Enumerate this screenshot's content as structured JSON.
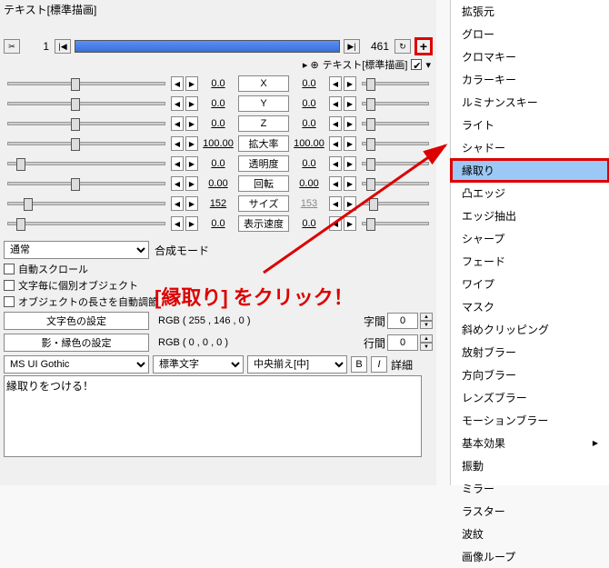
{
  "title": "テキスト[標準描画]",
  "timeline": {
    "start": "1",
    "end": "461"
  },
  "sub_header": "テキスト[標準描画]",
  "params": [
    {
      "lv": "0.0",
      "label": "X",
      "rv": "0.0",
      "lp": 40,
      "rp": 5
    },
    {
      "lv": "0.0",
      "label": "Y",
      "rv": "0.0",
      "lp": 40,
      "rp": 5
    },
    {
      "lv": "0.0",
      "label": "Z",
      "rv": "0.0",
      "lp": 40,
      "rp": 5
    },
    {
      "lv": "100.00",
      "label": "拡大率",
      "rv": "100.00",
      "lp": 40,
      "rp": 5
    },
    {
      "lv": "0.0",
      "label": "透明度",
      "rv": "0.0",
      "lp": 5,
      "rp": 5
    },
    {
      "lv": "0.00",
      "label": "回転",
      "rv": "0.00",
      "lp": 40,
      "rp": 5
    },
    {
      "lv": "152",
      "label": "サイズ",
      "rv": "153",
      "lp": 10,
      "rp": 10,
      "rdim": true
    },
    {
      "lv": "0.0",
      "label": "表示速度",
      "rv": "0.0",
      "lp": 5,
      "rp": 5
    }
  ],
  "blend_mode": {
    "value": "通常",
    "label": "合成モード"
  },
  "checkboxes": [
    "自動スクロール",
    "文字毎に個別オブジェクト",
    "オブジェクトの長さを自動調節"
  ],
  "color_buttons": {
    "text": "文字色の設定",
    "shadow": "影・縁色の設定"
  },
  "rgb": {
    "text": "RGB ( 255 , 146 , 0 )",
    "shadow": "RGB ( 0 , 0 , 0 )"
  },
  "spacing": {
    "char_label": "字間",
    "char_val": "0",
    "line_label": "行間",
    "line_val": "0"
  },
  "font": "MS UI Gothic",
  "char_type": "標準文字",
  "align": "中央揃え[中]",
  "bi": {
    "b": "B",
    "i": "I",
    "detail": "詳細"
  },
  "text_content": "縁取りをつける！",
  "menu": [
    {
      "label": "拡張元"
    },
    {
      "label": "グロー"
    },
    {
      "label": "クロマキー"
    },
    {
      "label": "カラーキー"
    },
    {
      "label": "ルミナンスキー"
    },
    {
      "label": "ライト"
    },
    {
      "label": "シャドー"
    },
    {
      "label": "縁取り",
      "hl": true,
      "boxed": true
    },
    {
      "label": "凸エッジ"
    },
    {
      "label": "エッジ抽出"
    },
    {
      "label": "シャープ"
    },
    {
      "label": "フェード"
    },
    {
      "label": "ワイプ"
    },
    {
      "label": "マスク"
    },
    {
      "label": "斜めクリッピング"
    },
    {
      "label": "放射ブラー"
    },
    {
      "label": "方向ブラー"
    },
    {
      "label": "レンズブラー"
    },
    {
      "label": "モーションブラー"
    },
    {
      "label": "基本効果",
      "sub": true
    },
    {
      "label": "振動"
    },
    {
      "label": "ミラー"
    },
    {
      "label": "ラスター"
    },
    {
      "label": "波紋"
    },
    {
      "label": "画像ループ"
    }
  ],
  "annotation": "[縁取り] をクリック！"
}
